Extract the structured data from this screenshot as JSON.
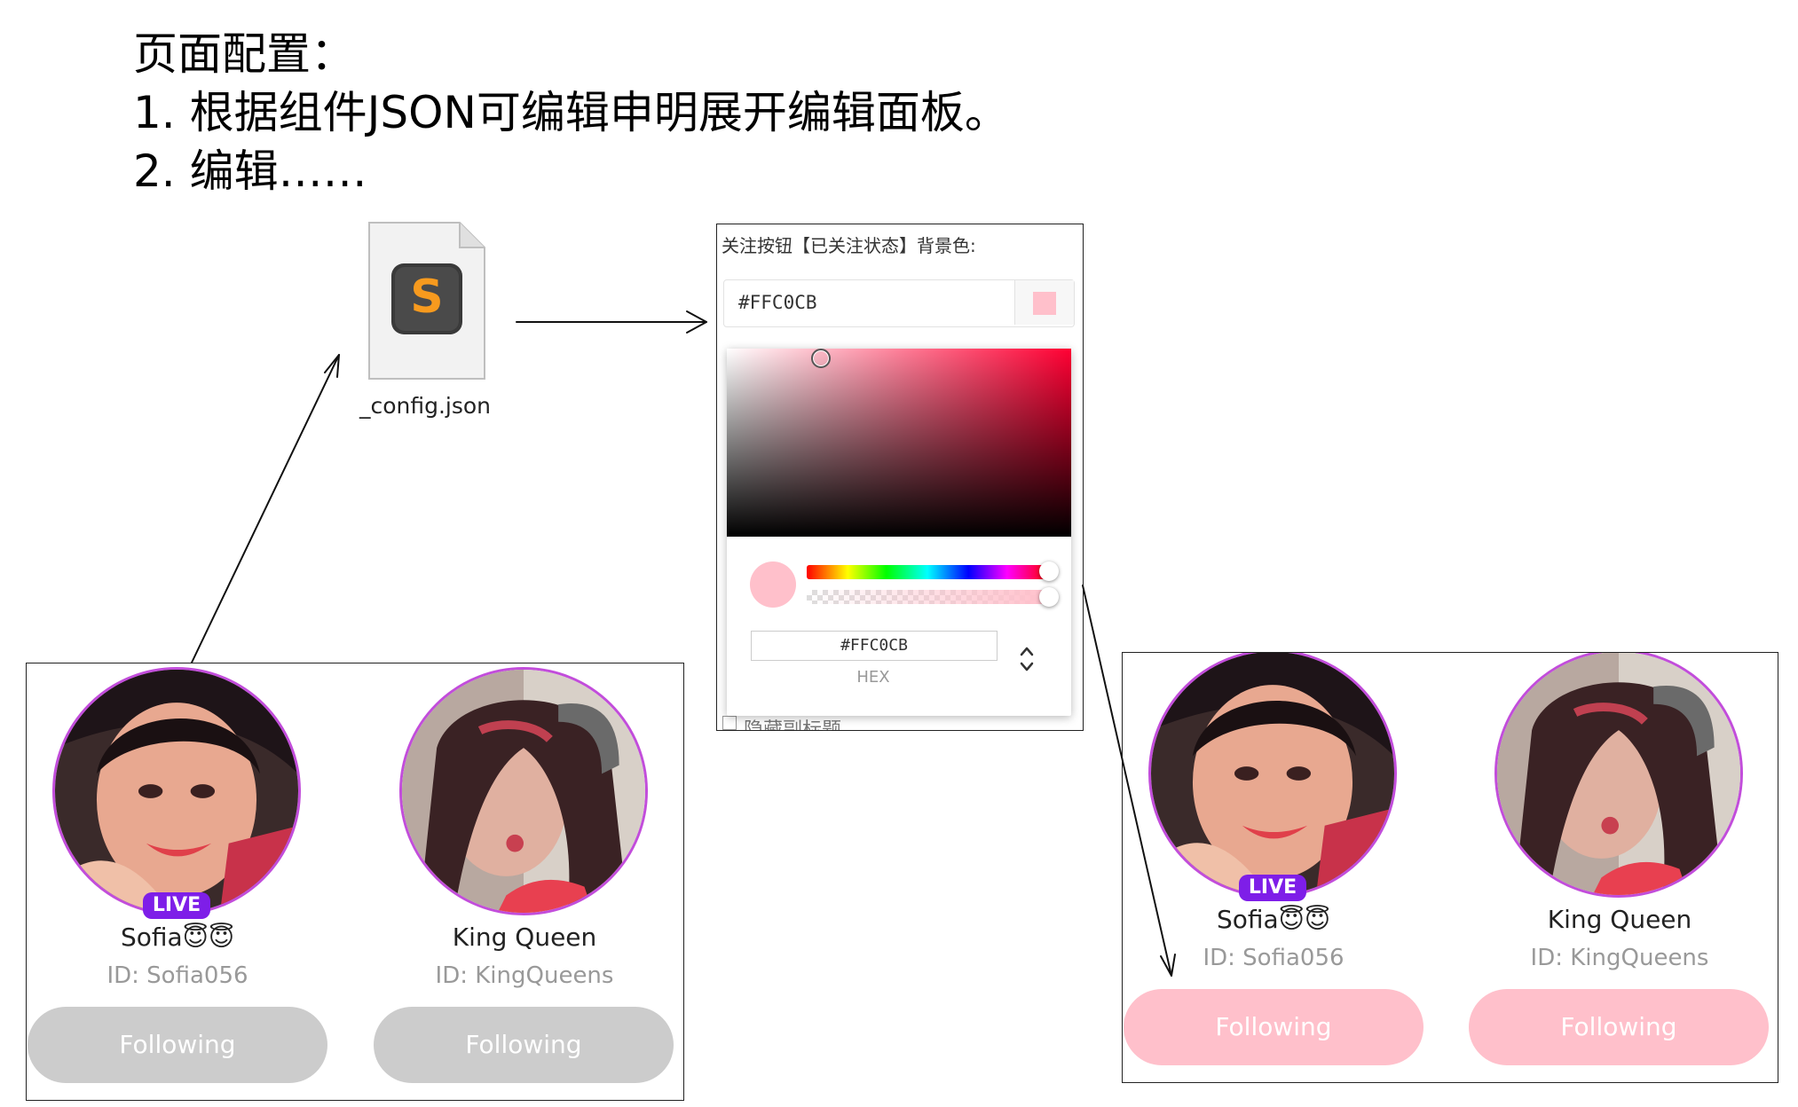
{
  "heading": {
    "line1": "页面配置：",
    "line2": "1.  根据组件JSON可编辑申明展开编辑面板。",
    "line3": "2.  编辑……"
  },
  "file": {
    "name": "_config.json",
    "icon": "sublime-text-icon"
  },
  "editor": {
    "title": "关注按钮【已关注状态】背景色:",
    "color_value": "#FFC0CB",
    "hidden_row_text": "隐藏副标题",
    "picker": {
      "hex_value": "#FFC0CB",
      "hex_label": "HEX"
    }
  },
  "colors": {
    "following_before": "#cccccc",
    "following_after": "#FFC0CB",
    "avatar_ring": "#c24ddb",
    "live_badge": "#7e1ee8"
  },
  "panel_before": {
    "users": [
      {
        "name": "Sofia😇😇",
        "id": "ID: Sofia056",
        "live": "LIVE",
        "button": "Following"
      },
      {
        "name": "King Queen",
        "id": "ID: KingQueens",
        "button": "Following"
      }
    ]
  },
  "panel_after": {
    "users": [
      {
        "name": "Sofia😇😇",
        "id": "ID: Sofia056",
        "live": "LIVE",
        "button": "Following"
      },
      {
        "name": "King Queen",
        "id": "ID: KingQueens",
        "button": "Following"
      }
    ]
  }
}
